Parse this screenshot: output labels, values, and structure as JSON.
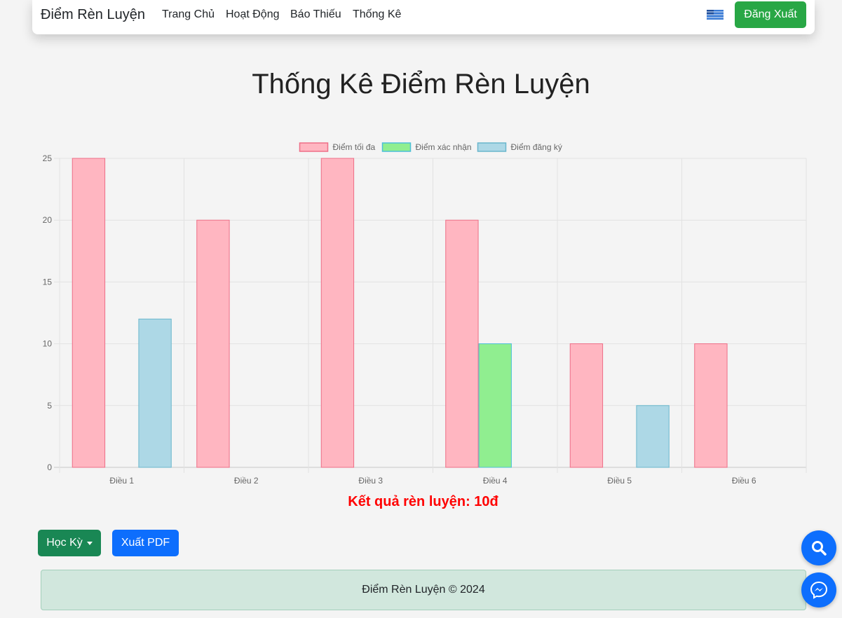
{
  "nav": {
    "brand": "Điểm Rèn Luyện",
    "links": [
      "Trang Chủ",
      "Hoạt Động",
      "Báo Thiếu",
      "Thống Kê"
    ],
    "language_icon": "flag-icon",
    "logout_label": "Đăng Xuất"
  },
  "page": {
    "title": "Thống Kê Điểm Rèn Luyện",
    "result_text": "Kết quả rèn luyện: 10đ",
    "semester_label": "Học Kỳ",
    "export_label": "Xuất PDF",
    "footer_text": "Điểm Rèn Luyện © 2024"
  },
  "floating": {
    "search_icon": "search-icon",
    "messenger_icon": "messenger-icon"
  },
  "colors": {
    "logout": "#28a745",
    "semester": "#198754",
    "export": "#0d6efd",
    "result": "#ff0000",
    "footer_bg": "#d1e7dd"
  },
  "chart_data": {
    "type": "bar",
    "categories": [
      "Điều 1",
      "Điều 2",
      "Điều 3",
      "Điều 4",
      "Điều 5",
      "Điều 6"
    ],
    "series": [
      {
        "name": "Điểm tối đa",
        "values": [
          25,
          20,
          25,
          20,
          10,
          10
        ],
        "color": "#ffb6c1",
        "border": "#ee6f87"
      },
      {
        "name": "Điểm xác nhận",
        "values": [
          0,
          0,
          0,
          10,
          0,
          0
        ],
        "color": "#90ee90",
        "border": "#4cbfd8"
      },
      {
        "name": "Điểm đăng ký",
        "values": [
          12,
          0,
          0,
          0,
          5,
          0
        ],
        "color": "#add8e6",
        "border": "#6ab6cc"
      }
    ],
    "yticks": [
      0,
      5,
      10,
      15,
      20,
      25
    ],
    "ylim": [
      0,
      25
    ],
    "legend": "top-center",
    "grid": true
  }
}
